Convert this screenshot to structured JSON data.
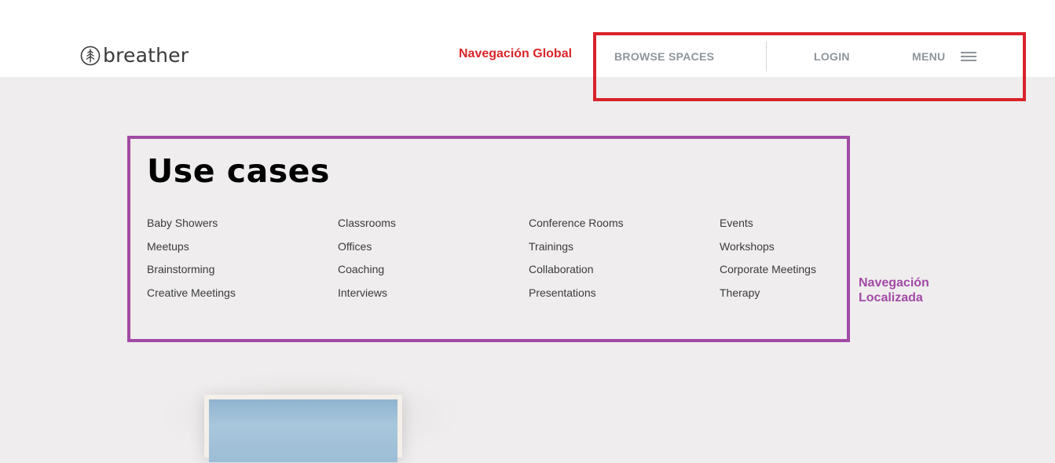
{
  "header": {
    "logo_text": "breather",
    "annotation_global": "Navegación Global",
    "nav": {
      "browse_label": "BROWSE SPACES",
      "login_label": "LOGIN",
      "menu_label": "MENU"
    }
  },
  "main": {
    "title": "Use cases",
    "use_cases": [
      [
        "Baby Showers",
        "Meetups",
        "Brainstorming",
        "Creative Meetings"
      ],
      [
        "Classrooms",
        "Offices",
        "Coaching",
        "Interviews"
      ],
      [
        "Conference Rooms",
        "Trainings",
        "Collaboration",
        "Presentations"
      ],
      [
        "Events",
        "Workshops",
        "Corporate Meetings",
        "Therapy"
      ]
    ],
    "annotation_local_line1": "Navegación",
    "annotation_local_line2": "Localizada"
  },
  "colors": {
    "annotation_red": "#d9222a",
    "annotation_purple": "#a24aa5",
    "nav_text": "#8e959c",
    "page_bg": "#efedee"
  },
  "icons": [
    "breather-leaf-icon",
    "hamburger-menu-icon"
  ]
}
